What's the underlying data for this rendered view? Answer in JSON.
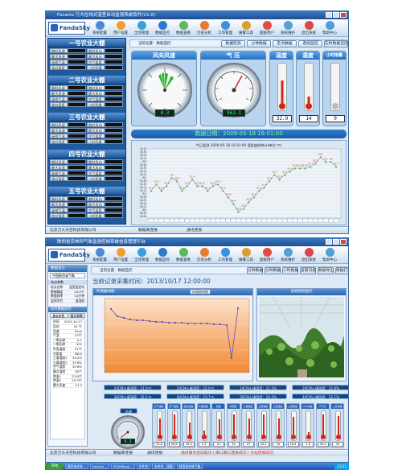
{
  "s1": {
    "title": "Focams 万大在线式温室自动监测系统软件(V1.0)",
    "logo": "FandaSky",
    "toolbar": [
      "系统配置",
      "用户设置",
      "全场管理",
      "数据监控",
      "数据查看",
      "历史分析",
      "工作管理",
      "报警工具",
      "超级用户",
      "系统维护",
      "退出系统",
      "帮助中心"
    ],
    "breadcrumb": "当前位置：数据监控",
    "nav_buttons": [
      "数据检测",
      "分钟数据",
      "定点数据",
      "连续监控",
      "实时数据监控"
    ],
    "greenhouses": [
      {
        "name": "一号农业大棚"
      },
      {
        "name": "二号农业大棚"
      },
      {
        "name": "三号农业大棚"
      },
      {
        "name": "四号农业大棚"
      },
      {
        "name": "五号农业大棚"
      }
    ],
    "row_labels": [
      [
        "瞬时风速",
        "瞬时风向"
      ],
      [
        "最大风速",
        "最大风向"
      ],
      [
        "采样气温",
        "空气湿度"
      ],
      [
        "相对湿度",
        "小时雨量"
      ]
    ],
    "gauges": {
      "wind_dir": {
        "title": "风向风速",
        "value": "0.3"
      },
      "pressure": {
        "title": "气  压",
        "value": "961.1"
      },
      "temp": {
        "title": "温度",
        "value": "32.9"
      },
      "humidity": {
        "title": "湿度",
        "value": "14"
      },
      "rain": {
        "title": "小时雨量",
        "value": "0"
      }
    },
    "banner": "数据日期：2009-05-18 16:01:00",
    "chart_title": "今日监测 2009-05-18 16:01:00 温度曲线统计(单位:℃)",
    "status_left": "北京万大天空科技有限公司",
    "status_mid": "数据库连接",
    "status_right": "通讯连接"
  },
  "chart_data": {
    "type": "line",
    "title": "今日监测 2009-05-18 16:01:00 温度曲线统计(单位:℃)",
    "ylim": [
      29.5,
      33.8
    ],
    "yticks": [
      "33.8",
      "33.6",
      "33.4",
      "33.2",
      "33",
      "32.8",
      "32.6",
      "32.4",
      "32.2",
      "32",
      "31.8",
      "31.6",
      "31.4",
      "31.2",
      "31",
      "30.8",
      "30.6",
      "30.4",
      "30.2",
      "30",
      "29.8",
      "29.6"
    ],
    "values": [
      31.2,
      31.6,
      31.2,
      31.5,
      32.0,
      31.8,
      31.2,
      31.5,
      31.9,
      31.5,
      31.5,
      31.2,
      31.5,
      31.6,
      31.2,
      30.8,
      30.4,
      29.9,
      30.1,
      30.5,
      30.8,
      31.2,
      31.4,
      31.8,
      32.2,
      31.9,
      32.2,
      32.4,
      32.6,
      32.6,
      32.6,
      32.7,
      32.9,
      33.3,
      33.0,
      33.0,
      32.7
    ],
    "point_labels": [
      "31.2",
      "31.6",
      "31.2",
      "31.5",
      "32",
      "31.8",
      "31.2",
      "31.5",
      "31.9",
      "31.5",
      "31.5",
      "31.2",
      "31.5",
      "31.6",
      "31.2",
      "30.8",
      "30.4",
      "29.9",
      "30.1",
      "30.5",
      "30.8",
      "31.2",
      "31.4",
      "31.8",
      "32.2",
      "31.9",
      "32.2",
      "32.4",
      "32.6",
      "32.6",
      "32.6",
      "32.7",
      "32.9",
      "33.3",
      "33",
      "33",
      "32.7"
    ]
  },
  "s2": {
    "title": "陕西省农林科气象监测控制系统信息管理平台",
    "logo": "FandaSky",
    "toolbar": [
      "系统配置",
      "用户设置",
      "全场管理",
      "数据监控",
      "数据查看",
      "历史分析",
      "工作管理",
      "报警工具",
      "超级用户",
      "系统维护",
      "退出系统",
      "帮助中心"
    ],
    "breadcrumb": "当前位置：数据监控",
    "nav_buttons": [
      "分钟数据",
      "分钟数据",
      "小时数据",
      "查看日报",
      "数据导出",
      "数据打印"
    ],
    "left_header": "数据设计",
    "tree_root": "中国陕西省气象",
    "station_header": "站点参数",
    "station_rows": [
      [
        "站点名称",
        "温室监控站"
      ],
      [
        "数据精度",
        "24.0℃"
      ],
      [
        "数据频率",
        "10分钟"
      ],
      [
        "监测项目",
        "温湿度"
      ]
    ],
    "realtime_header": "实时数据监控",
    "realtime_tabs": [
      "基础参数",
      "重点参数"
    ],
    "realtime_rows": [
      [
        "时间",
        "2013-10-17"
      ],
      [
        "风向",
        "24 ℃"
      ],
      [
        "风速",
        "3m/s"
      ],
      [
        "气温",
        "23℃"
      ],
      [
        "一氧化碳",
        "0.1"
      ],
      [
        "二氧化碳",
        "420"
      ],
      [
        "叶面温度",
        "21℃"
      ],
      [
        "光照度",
        "3820"
      ],
      [
        "土壤湿度1",
        "34.2%"
      ],
      [
        "土壤湿度2",
        "33.8%"
      ],
      [
        "空气湿度",
        "20.8%"
      ],
      [
        "露点温度",
        "18℃"
      ],
      [
        "地温1",
        "23.6℃"
      ],
      [
        "地温2",
        "25.5℃"
      ],
      [
        "最大风速",
        "13.3"
      ]
    ],
    "datetime": "当前记录采集时间：2013/10/17 12:00:00",
    "chart_title": "风速曲线图",
    "chart_btn": "风速曲线图",
    "image_title": "远程视频监控",
    "readouts": [
      "10CM土壤温度：21.0℃",
      "20CM土壤温度：22.0℃",
      "10CM土壤湿度：21.2%",
      "20CM土壤湿度：22.8%",
      "30CM土壤温度：22.1℃",
      "40CM土壤温度：23.7℃",
      "30CM土壤湿度：24.4%",
      "40CM土壤湿度：25.1%"
    ],
    "gauge_label": "风速",
    "gauge_value": "0.3",
    "tube_labels": [
      "空气温度",
      "空气湿度",
      "露点温度",
      "叶面湿度",
      "地温",
      "光照度",
      "土壤温度",
      "土壤湿度",
      "土壤温度",
      "土壤湿度",
      "CO2浓度",
      "大气压",
      "二氧化碳"
    ],
    "tube_values": [
      "23.8",
      "34.6",
      "15.2",
      "2.5",
      "21",
      "34",
      "27",
      "34.2",
      "24",
      "26.4",
      "1.8",
      "34.5",
      "32"
    ],
    "status_left": "北京万大天空科技有限公司",
    "status_mid": "数据库连接",
    "status_right": "通讯连接",
    "notice": "通讯服务启动成功 | 串口端口连接成功 | 主站连接成功"
  },
  "taskbar": {
    "start": "开始",
    "items": [
      "陕西省农林...",
      "Focams...",
      "SONVBook...",
      "文件夹",
      "未命名 - 画图",
      "陕西省农林气象"
    ],
    "clock": "13:21"
  }
}
